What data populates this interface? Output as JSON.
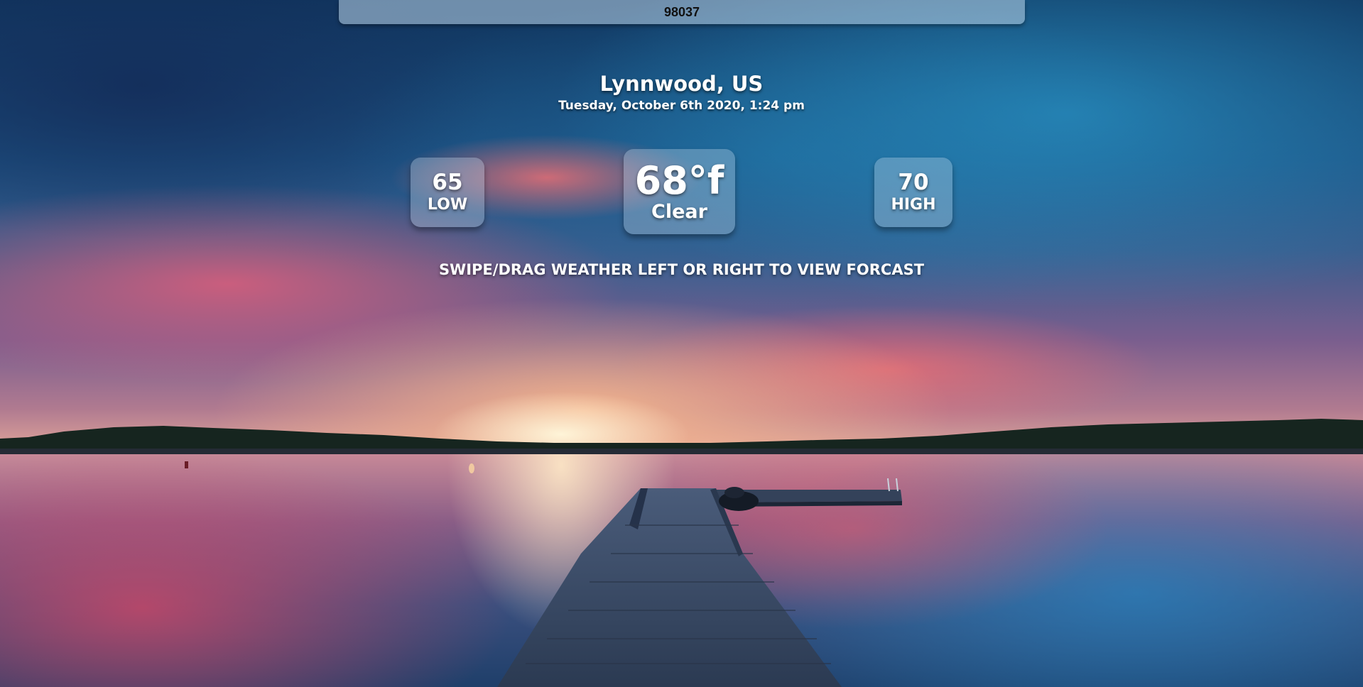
{
  "search": {
    "zip_value": "98037"
  },
  "weather": {
    "location": "Lynnwood, US",
    "datetime": "Tuesday, October 6th 2020, 1:24 pm",
    "current": {
      "temp": "68°f",
      "condition": "Clear"
    },
    "low": {
      "value": "65",
      "label": "LOW"
    },
    "high": {
      "value": "70",
      "label": "HIGH"
    }
  },
  "hint": "SWIPE/DRAG WEATHER LEFT OR RIGHT TO VIEW FORCAST",
  "colors": {
    "text": "#ffffff",
    "card_bg": "rgba(205,225,240,0.32)",
    "search_bg": "rgba(190,215,235,0.55)"
  }
}
